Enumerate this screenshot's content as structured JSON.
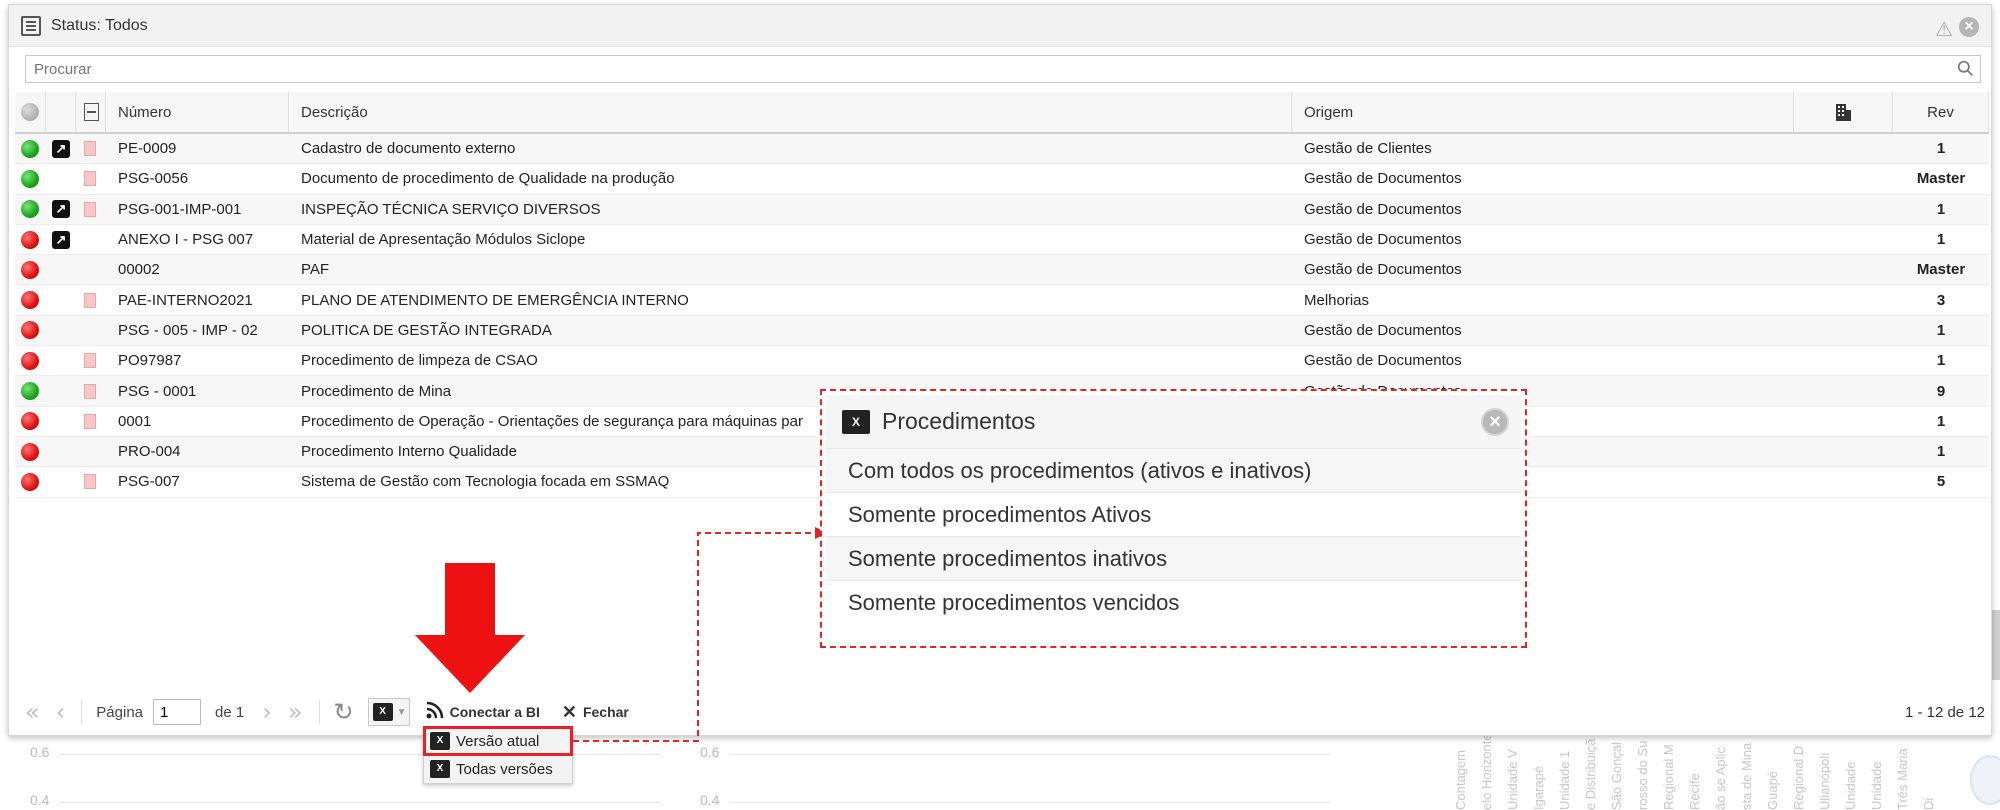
{
  "window": {
    "title": "Status: Todos",
    "warning_icon": "warning-icon",
    "close_icon": "close-icon"
  },
  "search": {
    "placeholder": "Procurar"
  },
  "table": {
    "columns": [
      "",
      "",
      "",
      "Número",
      "Descrição",
      "Origem",
      "",
      "Rev"
    ],
    "rows": [
      {
        "status": "green",
        "link": true,
        "pdf": true,
        "numero": "PE-0009",
        "descricao": "Cadastro de documento externo",
        "origem": "Gestão de Clientes",
        "rev": "1"
      },
      {
        "status": "green",
        "link": false,
        "pdf": true,
        "numero": "PSG-0056",
        "descricao": "Documento de procedimento de Qualidade na produção",
        "origem": "Gestão de Documentos",
        "rev": "Master"
      },
      {
        "status": "green",
        "link": true,
        "pdf": true,
        "numero": "PSG-001-IMP-001",
        "descricao": "INSPEÇÃO TÉCNICA SERVIÇO DIVERSOS",
        "origem": "Gestão de Documentos",
        "rev": "1"
      },
      {
        "status": "red",
        "link": true,
        "pdf": false,
        "numero": "ANEXO I - PSG 007",
        "descricao": "Material de Apresentação Módulos Siclope",
        "origem": "Gestão de Documentos",
        "rev": "1"
      },
      {
        "status": "red",
        "link": false,
        "pdf": false,
        "numero": "00002",
        "descricao": "PAF",
        "origem": "Gestão de Documentos",
        "rev": "Master"
      },
      {
        "status": "red",
        "link": false,
        "pdf": true,
        "numero": "PAE-INTERNO2021",
        "descricao": "PLANO DE ATENDIMENTO DE EMERGÊNCIA INTERNO",
        "origem": "Melhorias",
        "rev": "3"
      },
      {
        "status": "red",
        "link": false,
        "pdf": false,
        "numero": "PSG - 005 - IMP - 02",
        "descricao": "POLITICA DE GESTÃO INTEGRADA",
        "origem": "Gestão de Documentos",
        "rev": "1"
      },
      {
        "status": "red",
        "link": false,
        "pdf": true,
        "numero": "PO97987",
        "descricao": "Procedimento de limpeza de CSAO",
        "origem": "Gestão de Documentos",
        "rev": "1"
      },
      {
        "status": "green",
        "link": false,
        "pdf": true,
        "numero": "PSG - 0001",
        "descricao": "Procedimento de Mina",
        "origem": "Gestão de Documentos",
        "rev": "9"
      },
      {
        "status": "red",
        "link": false,
        "pdf": true,
        "numero": "0001",
        "descricao": "Procedimento de Operação - Orientações de segurança para máquinas par",
        "origem": "",
        "rev": "1"
      },
      {
        "status": "red",
        "link": false,
        "pdf": false,
        "numero": "PRO-004",
        "descricao": "Procedimento Interno Qualidade",
        "origem": "",
        "rev": "1"
      },
      {
        "status": "red",
        "link": false,
        "pdf": true,
        "numero": "PSG-007",
        "descricao": "Sistema de Gestão com Tecnologia focada em SSMAQ",
        "origem": "",
        "rev": "5"
      }
    ]
  },
  "pager": {
    "page_label": "Página",
    "page_value": "1",
    "of_label": "de 1",
    "bi_label": "Conectar a BI",
    "close_label": "Fechar",
    "count": "1 - 12 de 12"
  },
  "export_menu": {
    "items": [
      "Versão atual",
      "Todas versões"
    ]
  },
  "popup": {
    "title": "Procedimentos",
    "options": [
      "Com todos os procedimentos (ativos e inativos)",
      "Somente procedimentos Ativos",
      "Somente procedimentos inativos",
      "Somente procedimentos vencidos"
    ]
  },
  "background": {
    "axis_ticks": [
      "0.6",
      "0.4"
    ],
    "labels": [
      "Contagem",
      "elo Horizonte",
      "Unidade V",
      "Igarapé",
      "Unidade 1",
      "e Distribuiçã",
      "São Gonçal",
      "rosso do Su",
      "Regional M",
      "Recife",
      "ão se Aplic",
      "sta de Mina",
      "Guapé",
      "Regional D",
      "Ulianópoli",
      "Unidade",
      "Unidade",
      "Três Maria",
      "Di"
    ]
  },
  "colors": {
    "accent_red": "#e32424",
    "status_green": "#1aa51a",
    "status_red": "#e01010"
  }
}
